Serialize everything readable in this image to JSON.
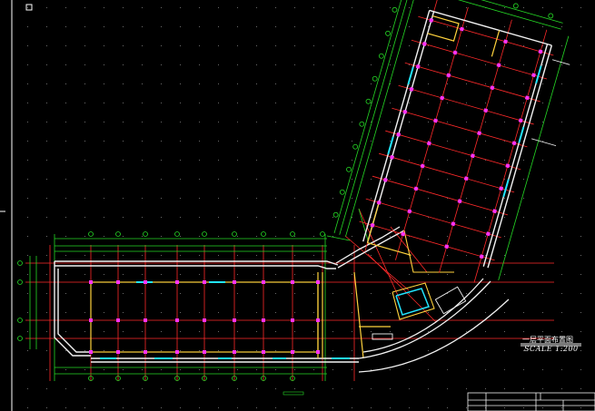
{
  "drawing": {
    "title": "一层平面布置图",
    "scale": "SCALE 1:200"
  },
  "colors": {
    "background": "#000000",
    "grid_axis": "#ff2a2a",
    "wall": "#f2f2f2",
    "dimension": "#25d925",
    "column": "#ff33ff",
    "partition": "#ffd23d",
    "glazing": "#22e5ff",
    "frame": "#ffffff"
  }
}
